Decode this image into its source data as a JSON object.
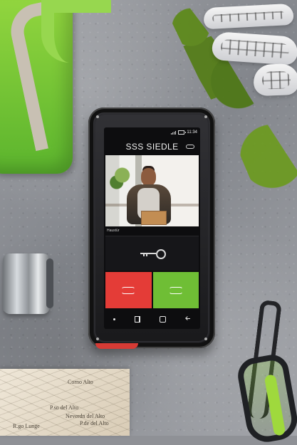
{
  "screen": {
    "status_time": "11:34",
    "app_title": "SSS SIEDLE",
    "camera_label": "Haustür"
  },
  "map": {
    "labels": [
      "Corno Alto",
      "P.so del Alto",
      "Neverdn del Alto",
      "P.de del Alto",
      "R.go Lunge"
    ]
  },
  "colors": {
    "decline": "#e43c37",
    "accept": "#6fbe35",
    "screen": "#0d0d0f",
    "device": "#1c1c1f"
  }
}
